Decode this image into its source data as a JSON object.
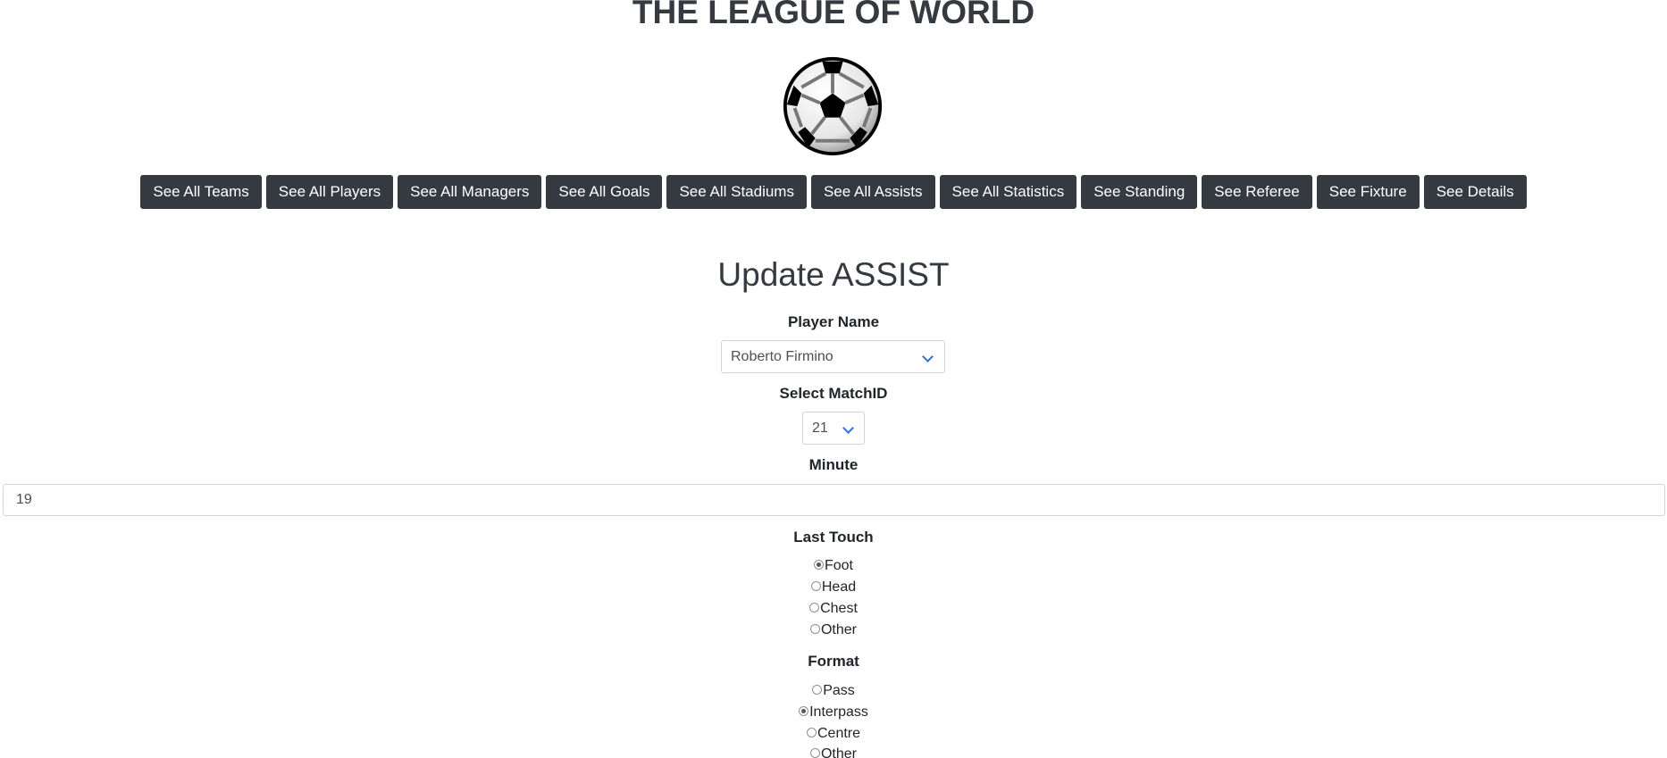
{
  "header": {
    "title": "THE LEAGUE OF WORLD",
    "logo_icon": "soccer-ball-icon"
  },
  "nav": {
    "buttons": [
      "See All Teams",
      "See All Players",
      "See All Managers",
      "See All Goals",
      "See All Stadiums",
      "See All Assists",
      "See All Statistics",
      "See Standing",
      "See Referee",
      "See Fixture",
      "See Details"
    ]
  },
  "form": {
    "title": "Update ASSIST",
    "player_name": {
      "label": "Player Name",
      "value": "Roberto Firmino"
    },
    "match_id": {
      "label": "Select MatchID",
      "value": "21"
    },
    "minute": {
      "label": "Minute",
      "value": "19"
    },
    "last_touch": {
      "label": "Last Touch",
      "options": [
        "Foot",
        "Head",
        "Chest",
        "Other"
      ],
      "selected": "Foot"
    },
    "format": {
      "label": "Format",
      "options": [
        "Pass",
        "Interpass",
        "Centre",
        "Other"
      ],
      "selected": "Interpass"
    }
  },
  "colors": {
    "nav_button_bg": "#343a40",
    "chevron": "#2d6fd6"
  }
}
